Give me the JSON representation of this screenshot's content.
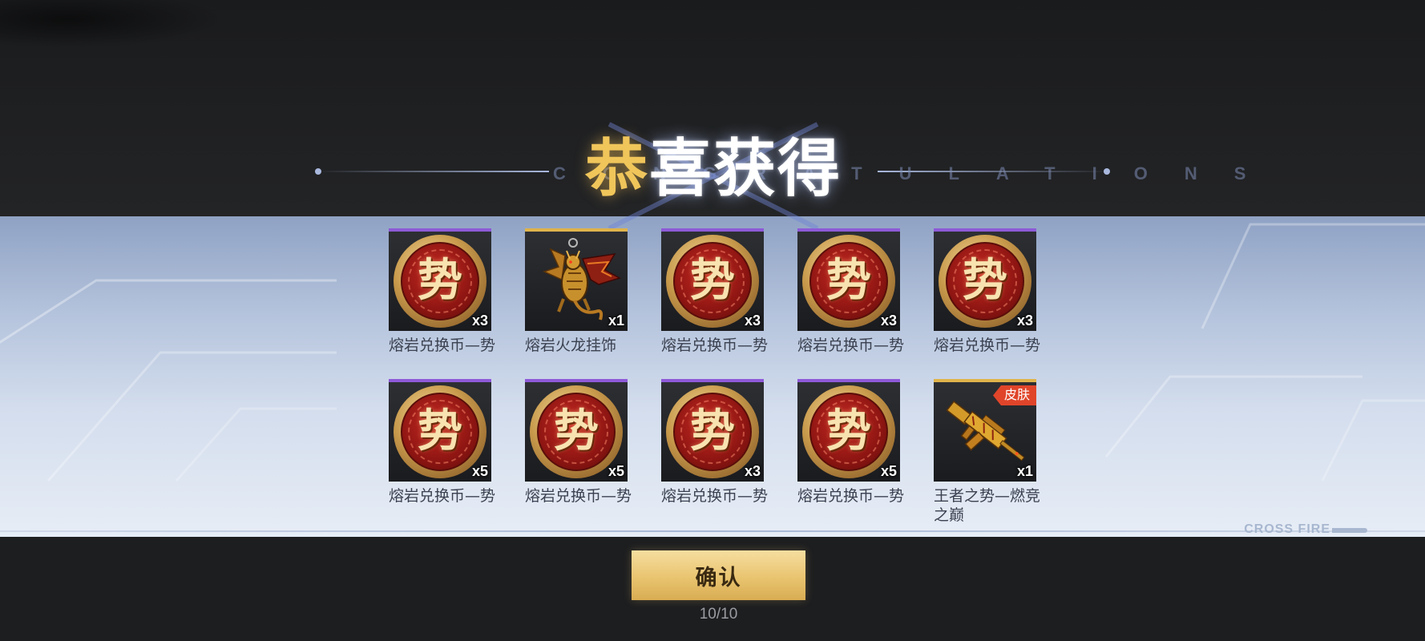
{
  "header": {
    "title_first": "恭",
    "title_rest": "喜获得",
    "subtitle": "CONGRATULATIONS"
  },
  "rewards": [
    {
      "name": "熔岩兑换币—势",
      "quantity": "x3",
      "icon": "lava-coin-icon",
      "tier_color": "#8e5ad8",
      "glyph": "势"
    },
    {
      "name": "熔岩火龙挂饰",
      "quantity": "x1",
      "icon": "fire-dragon-pendant-icon",
      "tier_color": "#e0b44b"
    },
    {
      "name": "熔岩兑换币—势",
      "quantity": "x3",
      "icon": "lava-coin-icon",
      "tier_color": "#8e5ad8",
      "glyph": "势"
    },
    {
      "name": "熔岩兑换币—势",
      "quantity": "x3",
      "icon": "lava-coin-icon",
      "tier_color": "#8e5ad8",
      "glyph": "势"
    },
    {
      "name": "熔岩兑换币—势",
      "quantity": "x3",
      "icon": "lava-coin-icon",
      "tier_color": "#8e5ad8",
      "glyph": "势"
    },
    {
      "name": "熔岩兑换币—势",
      "quantity": "x5",
      "icon": "lava-coin-icon",
      "tier_color": "#8e5ad8",
      "glyph": "势"
    },
    {
      "name": "熔岩兑换币—势",
      "quantity": "x5",
      "icon": "lava-coin-icon",
      "tier_color": "#8e5ad8",
      "glyph": "势"
    },
    {
      "name": "熔岩兑换币—势",
      "quantity": "x3",
      "icon": "lava-coin-icon",
      "tier_color": "#8e5ad8",
      "glyph": "势"
    },
    {
      "name": "熔岩兑换币—势",
      "quantity": "x5",
      "icon": "lava-coin-icon",
      "tier_color": "#8e5ad8",
      "glyph": "势"
    },
    {
      "name": "王者之势—燃竞之巅",
      "quantity": "x1",
      "icon": "rifle-skin-icon",
      "tier_color": "#e0b44b",
      "badge": "皮肤"
    }
  ],
  "footer": {
    "confirm_label": "确认",
    "progress": "10/10",
    "watermark": "CROSS FIRE"
  }
}
